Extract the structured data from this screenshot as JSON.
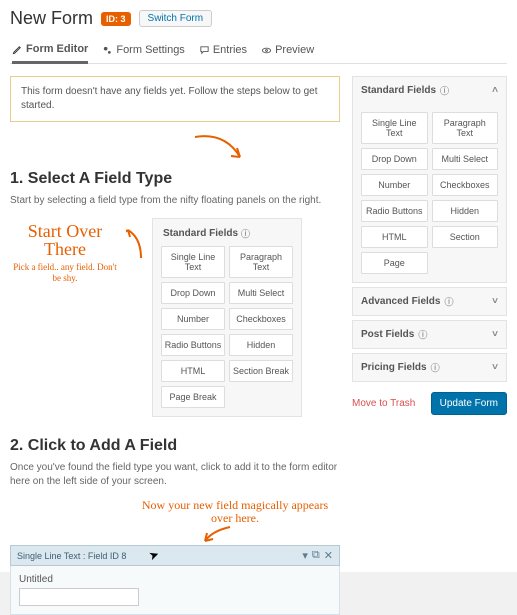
{
  "header": {
    "title": "New Form",
    "id_badge": "ID: 3",
    "switch_label": "Switch Form"
  },
  "tabs": {
    "editor": "Form Editor",
    "settings": "Form Settings",
    "entries": "Entries",
    "preview": "Preview"
  },
  "notice": "This form doesn't have any fields yet. Follow the steps below to get started.",
  "step1": {
    "heading": "1. Select A Field Type",
    "desc": "Start by selecting a field type from the nifty floating panels on the right.",
    "callout_big": "Start Over There",
    "callout_small": "Pick a field.. any field. Don't be shy."
  },
  "left_panel": {
    "title": "Standard Fields",
    "buttons": [
      "Single Line Text",
      "Paragraph Text",
      "Drop Down",
      "Multi Select",
      "Number",
      "Checkboxes",
      "Radio Buttons",
      "Hidden",
      "HTML",
      "Section Break",
      "Page Break"
    ]
  },
  "right_panels": {
    "standard": {
      "title": "Standard Fields",
      "buttons": [
        "Single Line Text",
        "Paragraph Text",
        "Drop Down",
        "Multi Select",
        "Number",
        "Checkboxes",
        "Radio Buttons",
        "Hidden",
        "HTML",
        "Section",
        "Page"
      ]
    },
    "advanced": "Advanced Fields",
    "post": "Post Fields",
    "pricing": "Pricing Fields"
  },
  "actions": {
    "trash": "Move to Trash",
    "update": "Update Form"
  },
  "step2": {
    "heading": "2. Click to Add A Field",
    "desc": "Once you've found the field type you want, click to add it to the form editor here on the left side of your screen.",
    "callout": "Now your new field magically appears over here."
  },
  "field_preview": {
    "bar_label": "Single Line Text : Field ID 8",
    "body_label": "Untitled"
  }
}
